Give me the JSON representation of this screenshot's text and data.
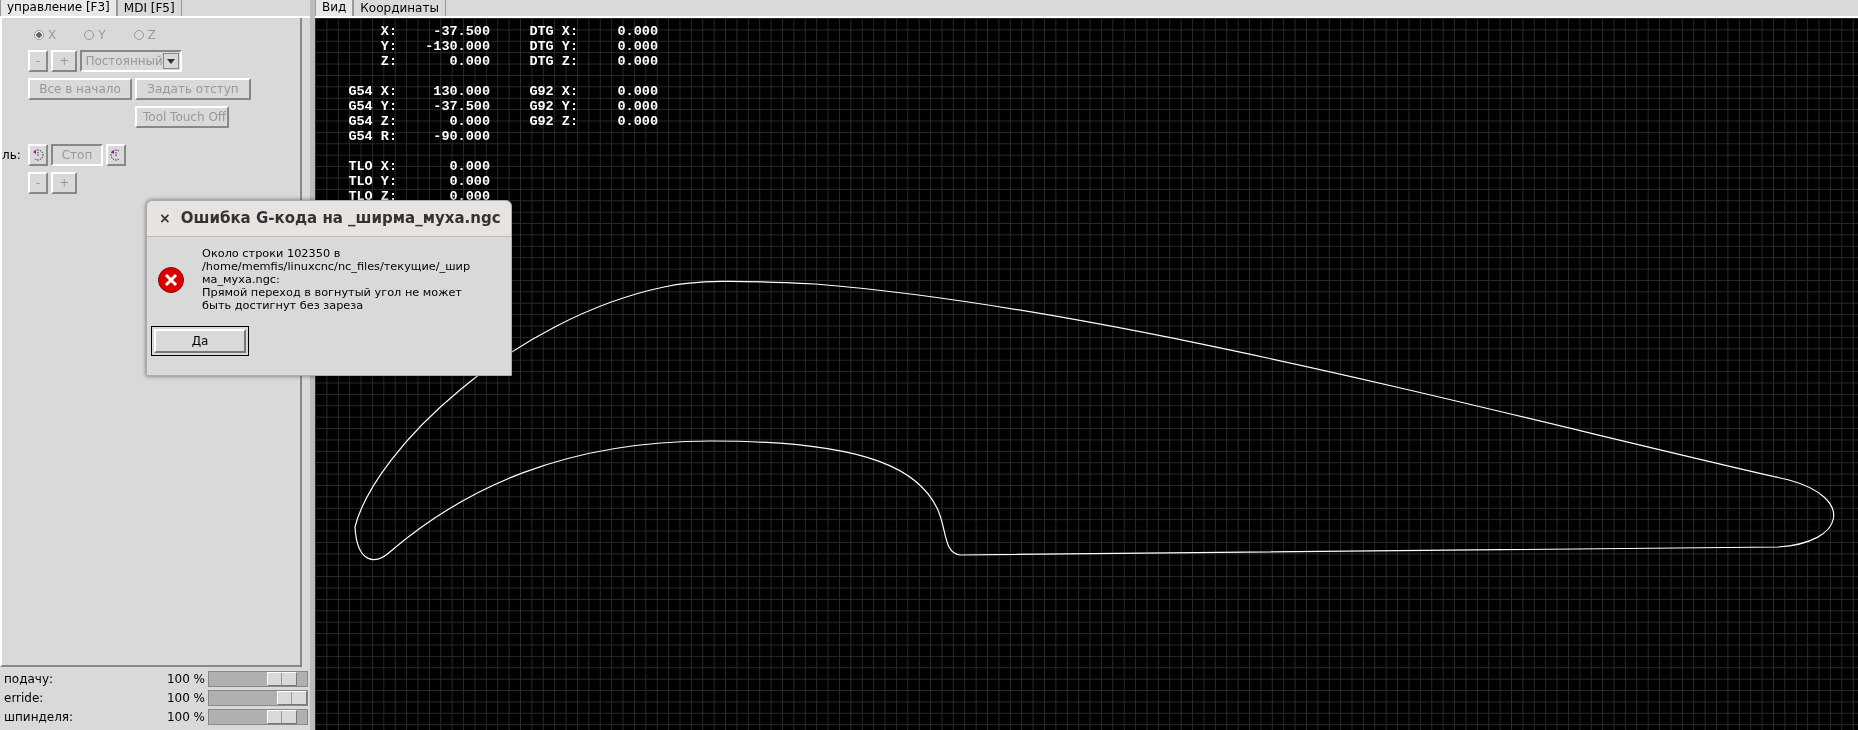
{
  "left_tabs": [
    {
      "label": "управление [F3]",
      "selected": true
    },
    {
      "label": "MDI [F5]",
      "selected": false
    }
  ],
  "axes": [
    {
      "label": "X",
      "selected": true,
      "disabled": true
    },
    {
      "label": "Y",
      "selected": false,
      "disabled": true
    },
    {
      "label": "Z",
      "selected": false,
      "disabled": true
    }
  ],
  "jog": {
    "minus": "-",
    "plus": "+",
    "mode": "Постоянный",
    "disabled": true
  },
  "buttons": [
    {
      "label": "Все в начало",
      "disabled": true
    },
    {
      "label": "Задать отступ",
      "disabled": true
    },
    {
      "label": "Tool Touch Off",
      "disabled": true
    }
  ],
  "spindle": {
    "label": "ль:",
    "stop": "Стоп",
    "minus": "-",
    "plus": "+",
    "disabled": true
  },
  "overrides": [
    {
      "label": "подачу:",
      "reading": "100 %",
      "level": 0.86
    },
    {
      "label": "erride:",
      "reading": "100 %",
      "level": 1.0
    },
    {
      "label": "шпинделя:",
      "reading": "100 %",
      "level": 0.86
    }
  ],
  "right_tabs": [
    {
      "label": "Вид",
      "selected": true
    },
    {
      "label": "Координаты",
      "selected": false
    }
  ],
  "dro": [
    [
      {
        "label": "X:",
        "value": "-37.500"
      },
      {
        "label": "DTG X:",
        "value": "0.000"
      }
    ],
    [
      {
        "label": "Y:",
        "value": "-130.000"
      },
      {
        "label": "DTG Y:",
        "value": "0.000"
      }
    ],
    [
      {
        "label": "Z:",
        "value": "0.000"
      },
      {
        "label": "DTG Z:",
        "value": "0.000"
      }
    ],
    [
      {
        "label": "G54 X:",
        "value": "130.000"
      },
      {
        "label": "G92 X:",
        "value": "0.000"
      }
    ],
    [
      {
        "label": "G54 Y:",
        "value": "-37.500"
      },
      {
        "label": "G92 Y:",
        "value": "0.000"
      }
    ],
    [
      {
        "label": "G54 Z:",
        "value": "0.000"
      },
      {
        "label": "G92 Z:",
        "value": "0.000"
      }
    ],
    [
      {
        "label": "G54 R:",
        "value": "-90.000"
      }
    ],
    [
      {
        "label": "TLO X:",
        "value": "0.000"
      }
    ],
    [
      {
        "label": "TLO Y:",
        "value": "0.000"
      }
    ],
    [
      {
        "label": "TLO Z:",
        "value": "0.000"
      }
    ]
  ],
  "dialog": {
    "close": "×",
    "title": "Ошибка G-кода на _ширма_муха.ngc",
    "message": "Около строки 102350 в\n/home/memfis/linuxcnc/nc_files/текущие/_шир\nма_муха.ngc:\nПрямой переход в вогнутый угол не может\nбыть достигнут без зареза",
    "button": "Да"
  }
}
